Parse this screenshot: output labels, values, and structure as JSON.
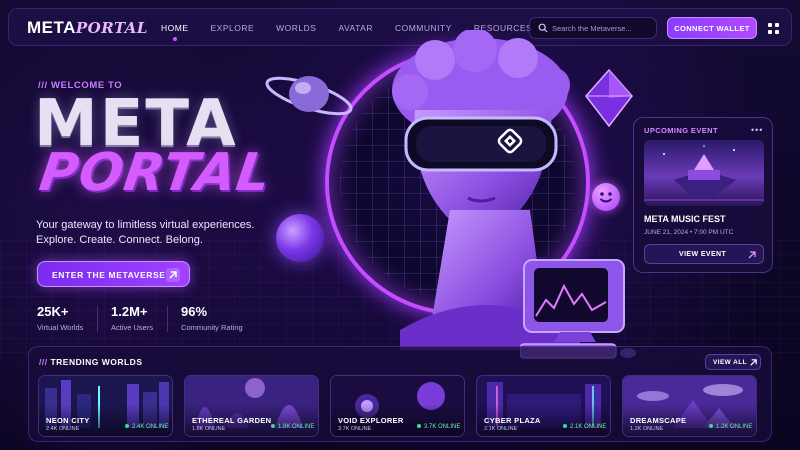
{
  "brand": {
    "part1": "META",
    "part2": "PORTAL"
  },
  "nav": {
    "links": [
      "HOME",
      "EXPLORE",
      "WORLDS",
      "AVATAR",
      "COMMUNITY",
      "RESOURCES"
    ],
    "active": "HOME"
  },
  "search": {
    "placeholder": "Search the Metaverse..."
  },
  "actions": {
    "connect_label": "CONNECT WALLET"
  },
  "icons": {
    "search": "search-icon",
    "menu": "grid-menu-icon",
    "arrow": "arrow-up-right-icon",
    "more": "more-dots-icon"
  },
  "hero": {
    "eyebrow": "/// WELCOME TO",
    "title_line1": "META",
    "title_line2": "PORTAL",
    "tagline": "Your gateway to limitless virtual experiences. Explore. Create. Connect. Belong.",
    "cta_label": "ENTER THE METAVERSE"
  },
  "stats": [
    {
      "value": "25K+",
      "label": "Virtual Worlds"
    },
    {
      "value": "1.2M+",
      "label": "Active Users"
    },
    {
      "value": "96%",
      "label": "Community Rating"
    }
  ],
  "event": {
    "heading": "UPCOMING EVENT",
    "more": "•••",
    "title": "META MUSIC FEST",
    "date": "JUNE 21, 2024  •  7:00 PM UTC",
    "button_label": "VIEW EVENT"
  },
  "trending": {
    "title_prefix": "///",
    "title": "TRENDING WORLDS",
    "view_all_label": "VIEW ALL",
    "worlds": [
      {
        "name": "NEON CITY",
        "sub": "2.4K ONLINE",
        "online": "2.4K ONLINE"
      },
      {
        "name": "ETHEREAL GARDEN",
        "sub": "1.8K ONLINE",
        "online": "1.8K ONLINE"
      },
      {
        "name": "VOID EXPLORER",
        "sub": "3.7K ONLINE",
        "online": "3.7K ONLINE"
      },
      {
        "name": "CYBER PLAZA",
        "sub": "2.1K ONLINE",
        "online": "2.1K ONLINE"
      },
      {
        "name": "DREAMSCAPE",
        "sub": "1.2K ONLINE",
        "online": "1.2K ONLINE"
      }
    ]
  },
  "colors": {
    "accent": "#b04bff",
    "accent_light": "#d45cff",
    "online": "#3ddc84",
    "background": "#0b0620"
  }
}
